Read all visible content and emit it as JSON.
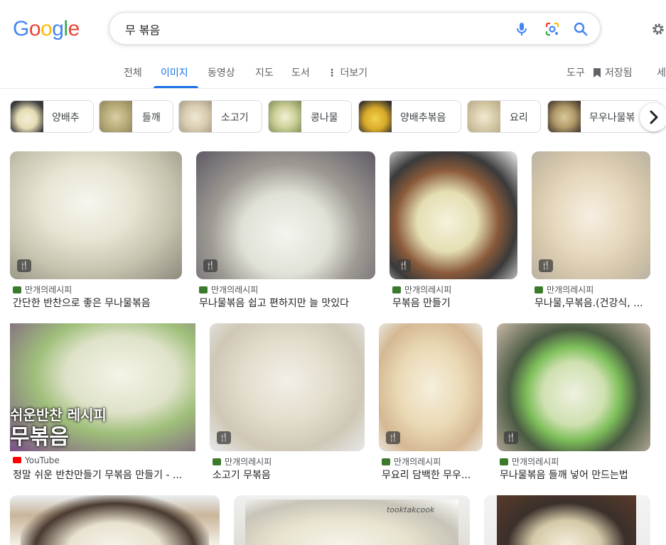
{
  "logo": {
    "letters": [
      "G",
      "o",
      "o",
      "g",
      "l",
      "e"
    ],
    "colors": [
      "#4285F4",
      "#EA4335",
      "#FBBC05",
      "#4285F4",
      "#34A853",
      "#EA4335"
    ]
  },
  "search": {
    "value": "무 볶음",
    "icons": [
      "mic-icon",
      "lens-icon",
      "search-icon"
    ]
  },
  "header": {
    "settings_icon": "gear-icon"
  },
  "tabs": [
    {
      "label": "전체"
    },
    {
      "label": "이미지",
      "active": true
    },
    {
      "label": "동영상"
    },
    {
      "label": "지도"
    },
    {
      "label": "도서"
    },
    {
      "label": "더보기"
    }
  ],
  "tools": {
    "tools_label": "도구",
    "saved_label": "저장됨",
    "safe_label": "세"
  },
  "chips": [
    {
      "label": "양배추"
    },
    {
      "label": "들깨"
    },
    {
      "label": "소고기"
    },
    {
      "label": "콩나물"
    },
    {
      "label": "양배추볶음"
    },
    {
      "label": "요리"
    },
    {
      "label": "무우나물볶"
    }
  ],
  "results": [
    {
      "source": "만개의레시피",
      "title": "간단한 반찬으로 좋은 무나물볶음",
      "recipe_badge": true
    },
    {
      "source": "만개의레시피",
      "title": "무나물볶음 쉽고 편하지만 늘 맛있다",
      "recipe_badge": true
    },
    {
      "source": "만개의레시피",
      "title": "무볶음 만들기",
      "recipe_badge": true
    },
    {
      "source": "만개의레시피",
      "title": "무나물,무볶음.(건강식, ...",
      "recipe_badge": true
    },
    {
      "source": "YouTube",
      "title": "정말 쉬운 반찬만들기 무볶음 만들기 - ...",
      "overlay_line1": "쉬운반찬 레시피",
      "overlay_line2": "무볶음",
      "recipe_badge": false
    },
    {
      "source": "만개의레시피",
      "title": "소고기 무볶음",
      "recipe_badge": true
    },
    {
      "source": "만개의레시피",
      "title": "무요리 담백한 무우...",
      "recipe_badge": true
    },
    {
      "source": "만개의레시피",
      "title": "무나물볶음 들깨 넣어 만드는법",
      "recipe_badge": true
    }
  ],
  "third_row": [
    {
      "overlay": ""
    },
    {
      "overlay": "tooktakcook"
    },
    {
      "overlay": ""
    }
  ]
}
